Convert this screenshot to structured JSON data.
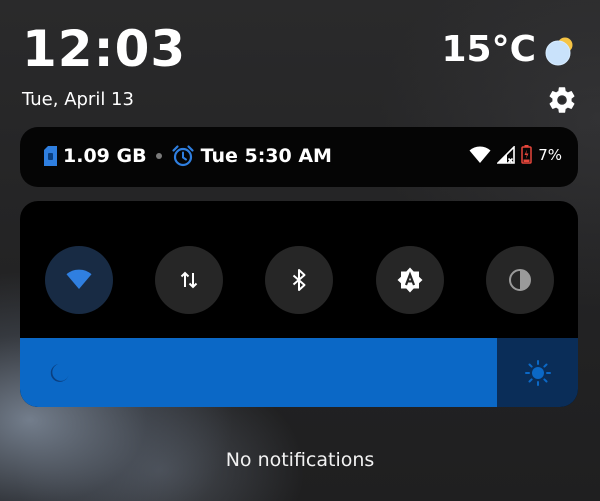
{
  "header": {
    "time": "12:03",
    "date": "Tue, April 13",
    "temperature": "15°C",
    "weather_icon": "partly-sunny-icon",
    "settings_icon": "gear-icon"
  },
  "status": {
    "data_usage": "1.09 GB",
    "alarm": "Tue 5:30 AM",
    "battery_percent": "7%",
    "icons": [
      "sim-card-icon",
      "alarm-clock-icon",
      "wifi-icon",
      "cell-signal-no-service-icon",
      "battery-charging-icon"
    ]
  },
  "quick_settings": {
    "tiles": [
      {
        "name": "wifi",
        "icon": "wifi-icon",
        "active": true
      },
      {
        "name": "mobile-data",
        "icon": "data-arrows-icon",
        "active": false
      },
      {
        "name": "bluetooth",
        "icon": "bluetooth-icon",
        "active": false
      },
      {
        "name": "auto-brightness",
        "icon": "auto-brightness-icon",
        "active": false
      },
      {
        "name": "dark-theme",
        "icon": "contrast-icon",
        "active": false
      }
    ],
    "brightness_level": 0.855
  },
  "notifications": {
    "empty_text": "No notifications"
  },
  "colors": {
    "accent": "#0b68c6",
    "accent_dark": "#0a2d58",
    "active_tile": "#182b44",
    "tile": "#262626",
    "battery_low": "#e8473c"
  }
}
